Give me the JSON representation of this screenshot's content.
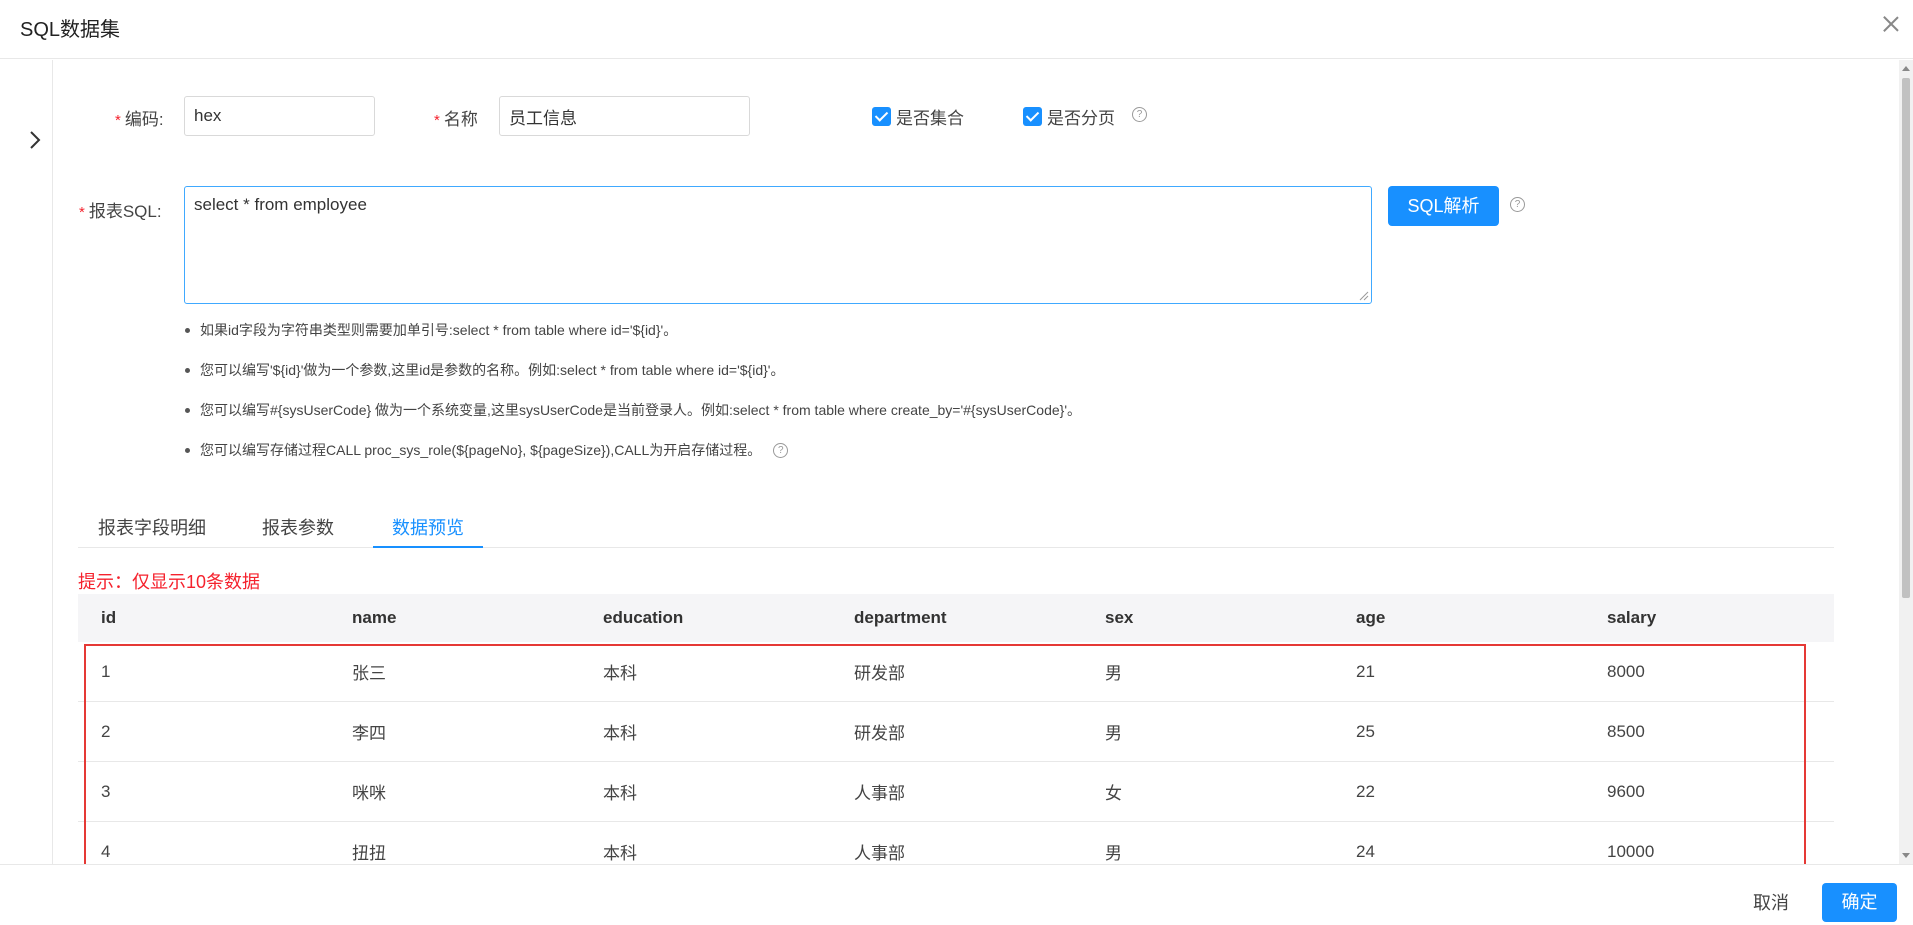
{
  "modal": {
    "title": "SQL数据集"
  },
  "form": {
    "code_label": "编码:",
    "code_value": "hex",
    "name_label": "名称",
    "name_value": "员工信息",
    "is_collection_label": "是否集合",
    "is_paging_label": "是否分页",
    "sql_label": "报表SQL:",
    "sql_value": "select *  from employee",
    "sql_parse_button": "SQL解析"
  },
  "hints": [
    "如果id字段为字符串类型则需要加单引号:select * from table where id='${id}'。",
    "您可以编写'${id}'做为一个参数,这里id是参数的名称。例如:select * from table where id='${id}'。",
    "您可以编写#{sysUserCode} 做为一个系统变量,这里sysUserCode是当前登录人。例如:select * from table where create_by='#{sysUserCode}'。",
    "您可以编写存储过程CALL proc_sys_role(${pageNo}, ${pageSize}),CALL为开启存储过程。"
  ],
  "tabs": [
    {
      "label": "报表字段明细"
    },
    {
      "label": "报表参数"
    },
    {
      "label": "数据预览"
    }
  ],
  "notice": "提示：仅显示10条数据",
  "table": {
    "columns": [
      "id",
      "name",
      "education",
      "department",
      "sex",
      "age",
      "salary"
    ],
    "rows": [
      [
        "1",
        "张三",
        "本科",
        "研发部",
        "男",
        "21",
        "8000"
      ],
      [
        "2",
        "李四",
        "本科",
        "研发部",
        "男",
        "25",
        "8500"
      ],
      [
        "3",
        "咪咪",
        "本科",
        "人事部",
        "女",
        "22",
        "9600"
      ],
      [
        "4",
        "扭扭",
        "本科",
        "人事部",
        "男",
        "24",
        "10000"
      ]
    ]
  },
  "footer": {
    "cancel": "取消",
    "confirm": "确定"
  },
  "icons": {
    "close": "close-icon",
    "expand": "chevron-right-icon",
    "help": "question-circle-icon"
  },
  "colors": {
    "primary": "#1890ff",
    "required": "#f5222d",
    "highlight": "#e53935"
  }
}
